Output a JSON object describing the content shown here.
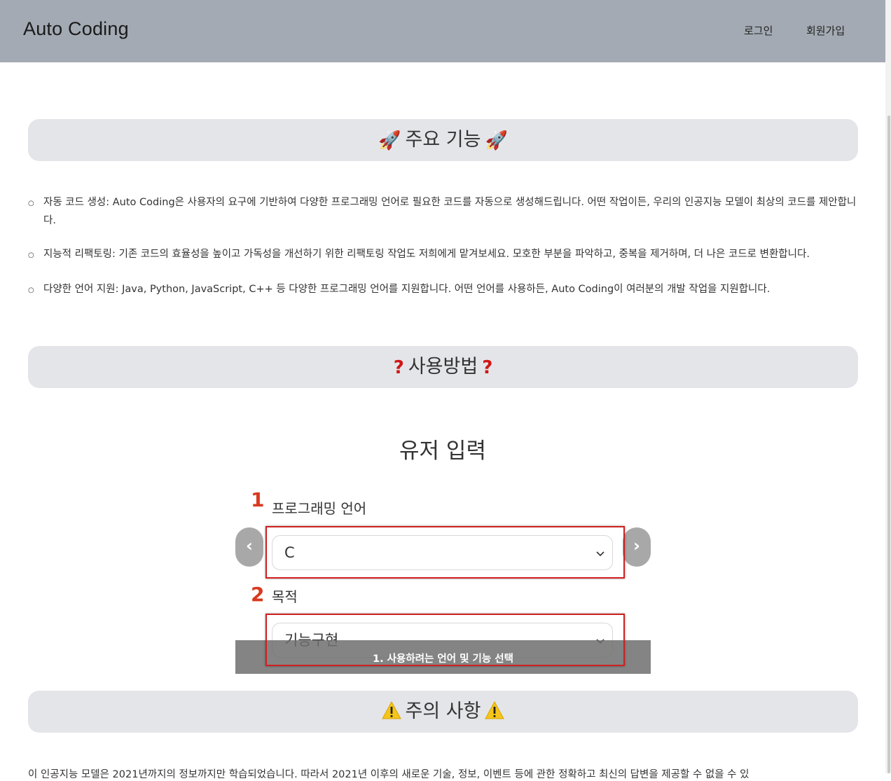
{
  "header": {
    "brand": "Auto Coding",
    "nav": {
      "login": "로그인",
      "signup": "회원가입"
    }
  },
  "sections": {
    "features_title": "주요 기능",
    "usage_title": "사용방법",
    "caution_title": "주의 사항",
    "icons": {
      "features": "rocket-icon",
      "usage": "red-question-icon",
      "caution": "warning-icon"
    }
  },
  "features": [
    {
      "text": "자동 코드 생성: Auto Coding은 사용자의 요구에 기반하여 다양한 프로그래밍 언어로 필요한 코드를 자동으로 생성해드립니다. 어떤 작업이든, 우리의 인공지능 모델이 최상의 코드를 제안합니다."
    },
    {
      "text": "지능적 리팩토링: 기존 코드의 효율성을 높이고 가독성을 개선하기 위한 리팩토링 작업도 저희에게 맡겨보세요. 모호한 부분을 파악하고, 중복을 제거하며, 더 나은 코드로 변환합니다."
    },
    {
      "text": "다양한 언어 지원: Java, Python, JavaScript, C++ 등 다양한 프로그래밍 언어를 지원합니다. 어떤 언어를 사용하든, Auto Coding이 여러분의 개발 작업을 지원합니다."
    }
  ],
  "user_input": {
    "title": "유저 입력",
    "step1_number": "1",
    "step2_number": "2",
    "language_label": "프로그래밍 언어",
    "language_value": "C",
    "purpose_label": "목적",
    "purpose_value": "기능구현",
    "prev_arrow": "‹",
    "next_arrow": "›",
    "caption": "1. 사용하려는 언어 및 기능 선택"
  },
  "caution_text": "이 인공지능 모델은 2021년까지의 정보까지만 학습되었습니다. 따라서 2021년 이후의 새로운 기술, 정보, 이벤트 등에 관한 정확하고 최신의 답변을 제공할 수 없을 수 있",
  "colors": {
    "header_bg": "#a3aab3",
    "section_bg": "#e4e5e9",
    "highlight": "#d02020",
    "step_number": "#d83a1e"
  }
}
